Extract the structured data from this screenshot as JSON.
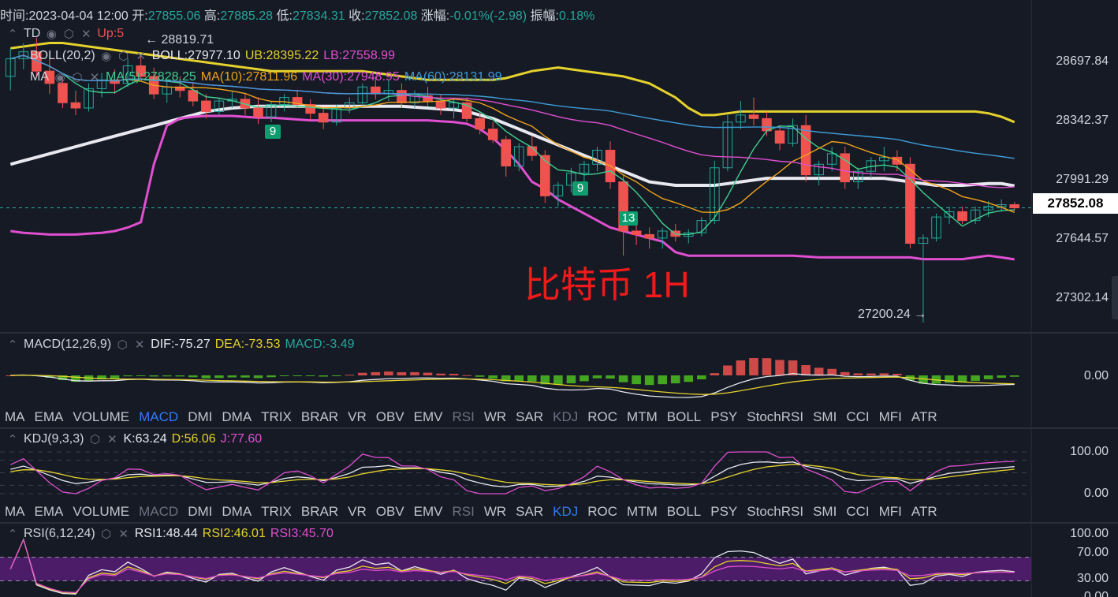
{
  "header": {
    "time_label": "时间:",
    "time_value": "2023-04-04 12:00",
    "open_label": "开:",
    "open_value": "27855.06",
    "high_label": "高:",
    "high_value": "27885.28",
    "low_label": "低:",
    "low_value": "27834.31",
    "close_label": "收:",
    "close_value": "27852.08",
    "change_label": "涨幅:",
    "change_value": "-0.01%(-2.98)",
    "amp_label": "振幅:",
    "amp_value": "0.18%"
  },
  "indicators": {
    "td": {
      "name": "TD",
      "value": "Up:5"
    },
    "boll": {
      "name": "BOLL(20,2)",
      "mid": "BOLL:27977.10",
      "ub": "UB:28395.22",
      "lb": "LB:27558.99"
    },
    "ma": {
      "name": "MA",
      "ma5": "MA(5):27828.25",
      "ma10": "MA(10):27811.96",
      "ma30": "MA(30):27948.95",
      "ma60": "MA(60):28131.99"
    },
    "macd": {
      "name": "MACD(12,26,9)",
      "dif": "DIF:-75.27",
      "dea": "DEA:-73.53",
      "macd": "MACD:-3.49"
    },
    "kdj": {
      "name": "KDJ(9,3,3)",
      "k": "K:63.24",
      "d": "D:56.06",
      "j": "J:77.60"
    },
    "rsi": {
      "name": "RSI(6,12,24)",
      "rsi1": "RSI1:48.44",
      "rsi2": "RSI2:46.01",
      "rsi3": "RSI3:45.70"
    }
  },
  "tabs": [
    "MA",
    "EMA",
    "VOLUME",
    "MACD",
    "DMI",
    "DMA",
    "TRIX",
    "BRAR",
    "VR",
    "OBV",
    "EMV",
    "RSI",
    "WR",
    "SAR",
    "KDJ",
    "ROC",
    "MTM",
    "BOLL",
    "PSY",
    "StochRSI",
    "SMI",
    "CCI",
    "MFI",
    "ATR"
  ],
  "tabs_row1_active": "MACD",
  "tabs_row2_active": "KDJ",
  "tabs_dim": [
    "RSI",
    "KDJ"
  ],
  "tabs_dim_row2": [
    "MACD",
    "RSI"
  ],
  "price_axis": [
    "28697.84",
    "28342.37",
    "27991.29",
    "27644.57",
    "27302.14"
  ],
  "current_price": "27852.08",
  "macd_axis": [
    "0.00"
  ],
  "kdj_axis": [
    "100.00",
    "0.00"
  ],
  "rsi_axis": [
    "100.00",
    "70.00",
    "30.00",
    "0.00"
  ],
  "annotations": {
    "high_marker": "← 28819.71",
    "low_marker": "27200.24 →",
    "watermark": "比特币 1H",
    "td_counts": [
      "9",
      "9",
      "13"
    ]
  },
  "icon_names": [
    "eye-icon",
    "settings-icon",
    "close-icon"
  ],
  "colors": {
    "bg": "#161a25",
    "up": "#26a69a",
    "down": "#ef5350",
    "boll_bands": "#e5d22c",
    "boll_mid": "#e8e8f0",
    "ma5": "#3fcf8e",
    "ma10": "#f0a21a",
    "ma30": "#e04fd0",
    "ma60": "#3f9bd6",
    "lb": "#e04fd0"
  },
  "chart_data": {
    "type": "candlestick",
    "title": "",
    "price_range": [
      27150,
      28900
    ],
    "candles": [
      [
        28600,
        28760,
        28520,
        28700
      ],
      [
        28700,
        28790,
        28640,
        28740
      ],
      [
        28740,
        28819.71,
        28600,
        28630
      ],
      [
        28630,
        28700,
        28500,
        28560
      ],
      [
        28560,
        28600,
        28420,
        28450
      ],
      [
        28450,
        28520,
        28380,
        28420
      ],
      [
        28420,
        28560,
        28400,
        28530
      ],
      [
        28530,
        28620,
        28480,
        28580
      ],
      [
        28580,
        28640,
        28500,
        28560
      ],
      [
        28560,
        28700,
        28540,
        28660
      ],
      [
        28660,
        28720,
        28580,
        28600
      ],
      [
        28600,
        28650,
        28470,
        28500
      ],
      [
        28500,
        28580,
        28450,
        28540
      ],
      [
        28540,
        28600,
        28480,
        28520
      ],
      [
        28520,
        28560,
        28430,
        28460
      ],
      [
        28460,
        28500,
        28360,
        28400
      ],
      [
        28400,
        28480,
        28380,
        28460
      ],
      [
        28460,
        28520,
        28420,
        28470
      ],
      [
        28470,
        28500,
        28380,
        28420
      ],
      [
        28420,
        28480,
        28330,
        28370
      ],
      [
        28370,
        28460,
        28340,
        28440
      ],
      [
        28440,
        28500,
        28400,
        28480
      ],
      [
        28480,
        28520,
        28420,
        28440
      ],
      [
        28440,
        28470,
        28350,
        28390
      ],
      [
        28390,
        28420,
        28300,
        28340
      ],
      [
        28340,
        28440,
        28320,
        28420
      ],
      [
        28420,
        28480,
        28390,
        28450
      ],
      [
        28450,
        28560,
        28430,
        28540
      ],
      [
        28540,
        28600,
        28470,
        28500
      ],
      [
        28500,
        28580,
        28460,
        28520
      ],
      [
        28520,
        28560,
        28420,
        28450
      ],
      [
        28450,
        28520,
        28420,
        28490
      ],
      [
        28490,
        28540,
        28430,
        28460
      ],
      [
        28460,
        28500,
        28380,
        28420
      ],
      [
        28420,
        28470,
        28360,
        28450
      ],
      [
        28450,
        28480,
        28340,
        28360
      ],
      [
        28360,
        28400,
        28270,
        28300
      ],
      [
        28300,
        28340,
        28220,
        28240
      ],
      [
        28240,
        28260,
        28030,
        28090
      ],
      [
        28090,
        28220,
        28060,
        28200
      ],
      [
        28200,
        28260,
        28120,
        28150
      ],
      [
        28150,
        28180,
        27880,
        27920
      ],
      [
        27920,
        28000,
        27860,
        27980
      ],
      [
        27980,
        28080,
        27940,
        28050
      ],
      [
        28050,
        28120,
        28000,
        28100
      ],
      [
        28100,
        28200,
        28060,
        28180
      ],
      [
        28180,
        28230,
        27960,
        28000
      ],
      [
        28000,
        28040,
        27580,
        27720
      ],
      [
        27720,
        27760,
        27640,
        27700
      ],
      [
        27700,
        27740,
        27620,
        27680
      ],
      [
        27680,
        27740,
        27620,
        27720
      ],
      [
        27720,
        27760,
        27660,
        27690
      ],
      [
        27690,
        27730,
        27650,
        27710
      ],
      [
        27710,
        27800,
        27690,
        27780
      ],
      [
        27780,
        28120,
        27760,
        28080
      ],
      [
        28080,
        28380,
        28060,
        28340
      ],
      [
        28340,
        28460,
        28300,
        28380
      ],
      [
        28380,
        28480,
        28320,
        28360
      ],
      [
        28360,
        28400,
        28260,
        28290
      ],
      [
        28290,
        28320,
        28180,
        28220
      ],
      [
        28220,
        28360,
        28200,
        28320
      ],
      [
        28320,
        28380,
        28000,
        28040
      ],
      [
        28040,
        28120,
        27980,
        28100
      ],
      [
        28100,
        28200,
        28060,
        28160
      ],
      [
        28160,
        28200,
        27960,
        28000
      ],
      [
        28000,
        28080,
        27960,
        28060
      ],
      [
        28060,
        28140,
        28020,
        28120
      ],
      [
        28120,
        28200,
        28060,
        28140
      ],
      [
        28140,
        28180,
        28060,
        28100
      ],
      [
        28100,
        28140,
        27620,
        27650
      ],
      [
        27650,
        27700,
        27200.24,
        27680
      ],
      [
        27680,
        27820,
        27660,
        27800
      ],
      [
        27800,
        27860,
        27760,
        27830
      ],
      [
        27830,
        27860,
        27760,
        27780
      ],
      [
        27780,
        27860,
        27760,
        27840
      ],
      [
        27840,
        27890,
        27800,
        27860
      ],
      [
        27860,
        27900,
        27830,
        27870
      ],
      [
        27870,
        27885.28,
        27834.31,
        27852.08
      ]
    ],
    "boll_ub": [
      28760,
      28770,
      28780,
      28790,
      28790,
      28780,
      28770,
      28760,
      28750,
      28740,
      28730,
      28720,
      28710,
      28700,
      28690,
      28680,
      28670,
      28660,
      28650,
      28640,
      28630,
      28630,
      28630,
      28630,
      28630,
      28630,
      28630,
      28630,
      28620,
      28610,
      28600,
      28590,
      28580,
      28580,
      28580,
      28580,
      28580,
      28580,
      28590,
      28610,
      28630,
      28640,
      28650,
      28640,
      28630,
      28620,
      28610,
      28600,
      28580,
      28560,
      28520,
      28480,
      28420,
      28380,
      28380,
      28390,
      28400,
      28400,
      28400,
      28400,
      28400,
      28400,
      28400,
      28400,
      28400,
      28400,
      28400,
      28400,
      28400,
      28400,
      28400,
      28400,
      28400,
      28400,
      28400,
      28390,
      28370,
      28340
    ],
    "boll_mid": [
      28100,
      28120,
      28140,
      28160,
      28180,
      28200,
      28220,
      28240,
      28260,
      28280,
      28300,
      28320,
      28340,
      28360,
      28380,
      28400,
      28410,
      28420,
      28425,
      28430,
      28430,
      28430,
      28430,
      28430,
      28430,
      28430,
      28430,
      28430,
      28430,
      28430,
      28430,
      28425,
      28420,
      28415,
      28410,
      28400,
      28380,
      28360,
      28330,
      28300,
      28270,
      28240,
      28210,
      28180,
      28150,
      28120,
      28090,
      28060,
      28030,
      28000,
      27990,
      27980,
      27980,
      27980,
      27980,
      27990,
      28000,
      28010,
      28020,
      28020,
      28020,
      28020,
      28020,
      28020,
      28020,
      28020,
      28020,
      28020,
      28010,
      28000,
      27990,
      27980,
      27980,
      27980,
      27985,
      27990,
      27990,
      27977
    ],
    "boll_lb": [
      27720,
      27710,
      27705,
      27700,
      27700,
      27700,
      27705,
      27710,
      27720,
      27740,
      27770,
      28100,
      28320,
      28360,
      28370,
      28375,
      28375,
      28375,
      28370,
      28365,
      28365,
      28360,
      28355,
      28350,
      28350,
      28350,
      28350,
      28350,
      28350,
      28350,
      28350,
      28350,
      28350,
      28345,
      28340,
      28330,
      28300,
      28250,
      28180,
      28100,
      28000,
      27960,
      27900,
      27860,
      27820,
      27780,
      27740,
      27720,
      27700,
      27680,
      27660,
      27600,
      27580,
      27580,
      27580,
      27580,
      27580,
      27580,
      27580,
      27580,
      27580,
      27575,
      27570,
      27570,
      27570,
      27570,
      27570,
      27570,
      27570,
      27570,
      27560,
      27560,
      27560,
      27560,
      27570,
      27580,
      27570,
      27559
    ]
  }
}
